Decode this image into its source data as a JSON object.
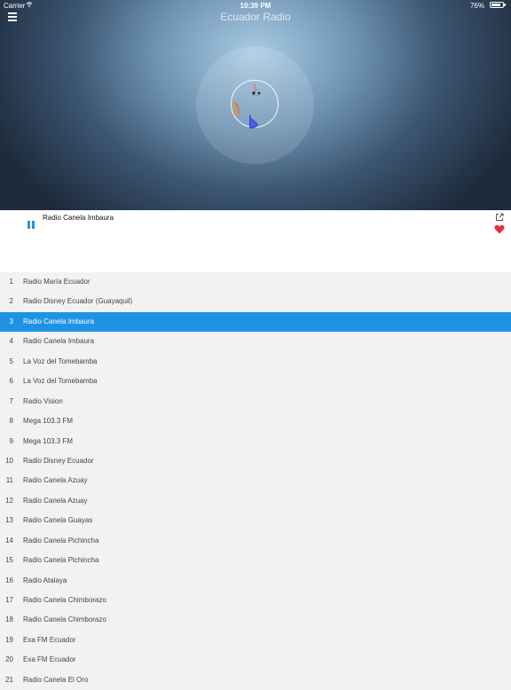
{
  "status_bar": {
    "carrier": "Carrier",
    "time": "10:39 PM",
    "battery": "76%"
  },
  "header": {
    "title": "Ecuador Radio"
  },
  "player": {
    "station": "Radio Canela Imbaura"
  },
  "stations": [
    {
      "num": "1",
      "name": "Radio María Ecuador"
    },
    {
      "num": "2",
      "name": "Radio Disney Ecuador (Guayaquil)"
    },
    {
      "num": "3",
      "name": "Radio Canela Imbaura"
    },
    {
      "num": "4",
      "name": "Radio Canela Imbaura"
    },
    {
      "num": "5",
      "name": "La Voz del Tomebamba"
    },
    {
      "num": "6",
      "name": "La Voz del Tomebamba"
    },
    {
      "num": "7",
      "name": "Radio Vision"
    },
    {
      "num": "8",
      "name": "Mega 103.3 FM"
    },
    {
      "num": "9",
      "name": "Mega 103.3 FM"
    },
    {
      "num": "10",
      "name": "Radio Disney Ecuador"
    },
    {
      "num": "11",
      "name": "Radio Canela Azuay"
    },
    {
      "num": "12",
      "name": "Radio Canela Azuay"
    },
    {
      "num": "13",
      "name": "Radio Canela Guayas"
    },
    {
      "num": "14",
      "name": "Radio Canela Pichincha"
    },
    {
      "num": "15",
      "name": "Radio Canela Pichincha"
    },
    {
      "num": "16",
      "name": "Radio Atalaya"
    },
    {
      "num": "17",
      "name": "Radio Canela Chimborazo"
    },
    {
      "num": "18",
      "name": "Radio Canela Chimborazo"
    },
    {
      "num": "19",
      "name": "Exa FM Ecuador"
    },
    {
      "num": "20",
      "name": "Exa FM Ecuador"
    },
    {
      "num": "21",
      "name": "Radio Canela El Oro"
    }
  ],
  "active_index": 2,
  "colors": {
    "accent": "#1f93e3",
    "heart": "#e8303c"
  },
  "icons": {
    "menu": "menu-icon",
    "pause": "pause-icon",
    "share": "share-icon",
    "favorite": "heart-icon",
    "logo": "music-notes-logo"
  }
}
